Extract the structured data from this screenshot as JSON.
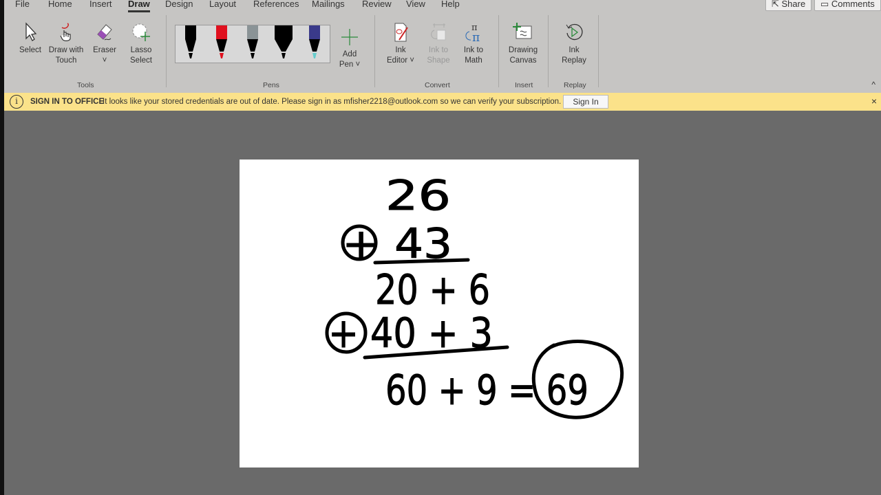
{
  "tabs": [
    "File",
    "Home",
    "Insert",
    "Draw",
    "Design",
    "Layout",
    "References",
    "Mailings",
    "Review",
    "View",
    "Help"
  ],
  "active_tab": "Draw",
  "share": "Share",
  "comments": "Comments",
  "tools": {
    "select": "Select",
    "draw_touch_1": "Draw with",
    "draw_touch_2": "Touch",
    "eraser": "Eraser",
    "lasso_1": "Lasso",
    "lasso_2": "Select",
    "group": "Tools"
  },
  "pens": {
    "add_1": "Add",
    "add_2": "Pen ˅",
    "group": "Pens",
    "colors": [
      "#000000",
      "#e0101e",
      "#8a9396",
      "#000000",
      "#3a3a8a"
    ]
  },
  "convert": {
    "ink_editor_1": "Ink",
    "ink_editor_2": "Editor ˅",
    "ink_shape_1": "Ink to",
    "ink_shape_2": "Shape",
    "ink_math_1": "Ink to",
    "ink_math_2": "Math",
    "group": "Convert"
  },
  "insert": {
    "canvas_1": "Drawing",
    "canvas_2": "Canvas",
    "group": "Insert"
  },
  "replay": {
    "label_1": "Ink",
    "label_2": "Replay",
    "group": "Replay"
  },
  "message": {
    "title": "SIGN IN TO OFFICE",
    "text": "It looks like your stored credentials are out of date. Please sign in as mfisher2218@outlook.com so we can verify your subscription.",
    "button": "Sign In",
    "close": "×"
  },
  "ink": {
    "lines": [
      "26",
      "+ 43",
      "20 + 6",
      "+ 40 + 3",
      "60 + 9 = 69"
    ]
  }
}
